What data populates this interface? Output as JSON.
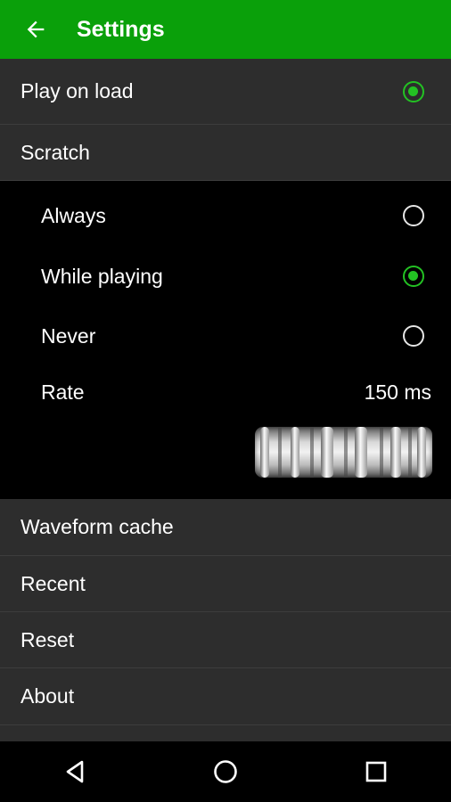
{
  "appbar": {
    "title": "Settings",
    "back_icon": "arrow-left-icon"
  },
  "play_on_load": {
    "label": "Play on load",
    "checked": true
  },
  "scratch": {
    "label": "Scratch",
    "options": [
      {
        "label": "Always",
        "checked": false
      },
      {
        "label": "While playing",
        "checked": true
      },
      {
        "label": "Never",
        "checked": false
      }
    ],
    "rate": {
      "label": "Rate",
      "value": "150 ms"
    }
  },
  "menu": {
    "waveform_cache": "Waveform cache",
    "recent": "Recent",
    "reset": "Reset",
    "about": "About"
  },
  "navbar": {
    "icons": [
      "back-triangle-icon",
      "home-circle-icon",
      "recents-square-icon"
    ]
  },
  "colors": {
    "accent": "#0aa00a",
    "radio_on": "#23c223",
    "row_bg": "#2d2d2d"
  }
}
